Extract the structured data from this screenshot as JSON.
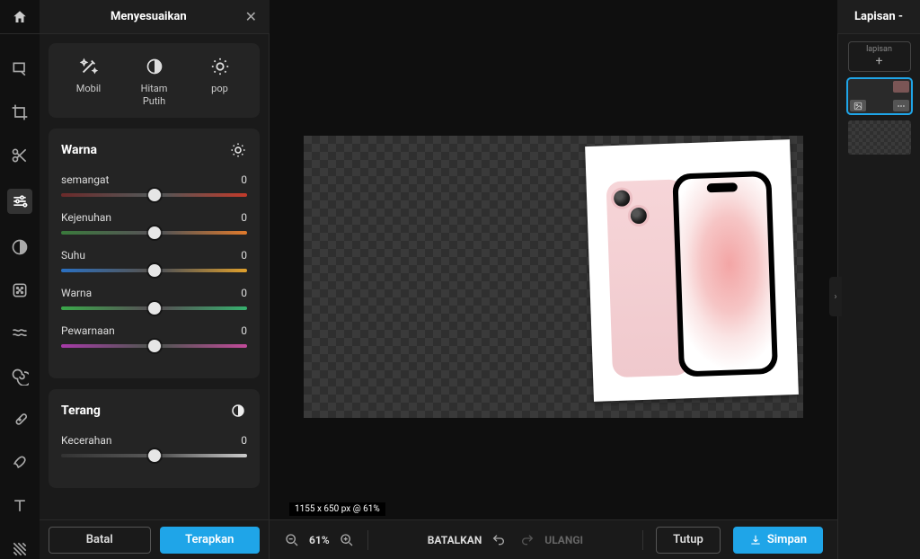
{
  "panel": {
    "title": "Menyesuaikan",
    "presets": [
      {
        "name": "mobil",
        "label": "Mobil",
        "icon": "wand"
      },
      {
        "name": "hitam-putih",
        "label": "Hitam\nPutih",
        "icon": "contrast"
      },
      {
        "name": "pop",
        "label": "pop",
        "icon": "sun-gear"
      }
    ],
    "groups": {
      "warna": {
        "title": "Warna",
        "sliders": [
          {
            "name": "semangat",
            "label": "semangat",
            "value": 0,
            "grad": "grad-vibrance"
          },
          {
            "name": "kejenuhan",
            "label": "Kejenuhan",
            "value": 0,
            "grad": "grad-saturation"
          },
          {
            "name": "suhu",
            "label": "Suhu",
            "value": 0,
            "grad": "grad-temperature"
          },
          {
            "name": "warna",
            "label": "Warna",
            "value": 0,
            "grad": "grad-hue"
          },
          {
            "name": "pewarnaan",
            "label": "Pewarnaan",
            "value": 0,
            "grad": "grad-tint"
          }
        ]
      },
      "terang": {
        "title": "Terang",
        "sliders": [
          {
            "name": "kecerahan",
            "label": "Kecerahan",
            "value": 0,
            "grad": "grad-brightness"
          }
        ]
      }
    },
    "footer": {
      "cancel": "Batal",
      "apply": "Terapkan"
    }
  },
  "layers": {
    "header": "Lapisan -",
    "add_label": "lapisan"
  },
  "canvas": {
    "dimensions_badge": "1155 x 650 px @ 61%",
    "zoom_percent": "61%"
  },
  "toolbar": {
    "undo": "BATALKAN",
    "redo": "ULANGI",
    "close": "Tutup",
    "save": "Simpan"
  },
  "tools": [
    "select",
    "crop",
    "cut",
    "adjust",
    "contrast",
    "grain",
    "liquify",
    "spiral",
    "heal",
    "brush",
    "text",
    "pattern"
  ]
}
